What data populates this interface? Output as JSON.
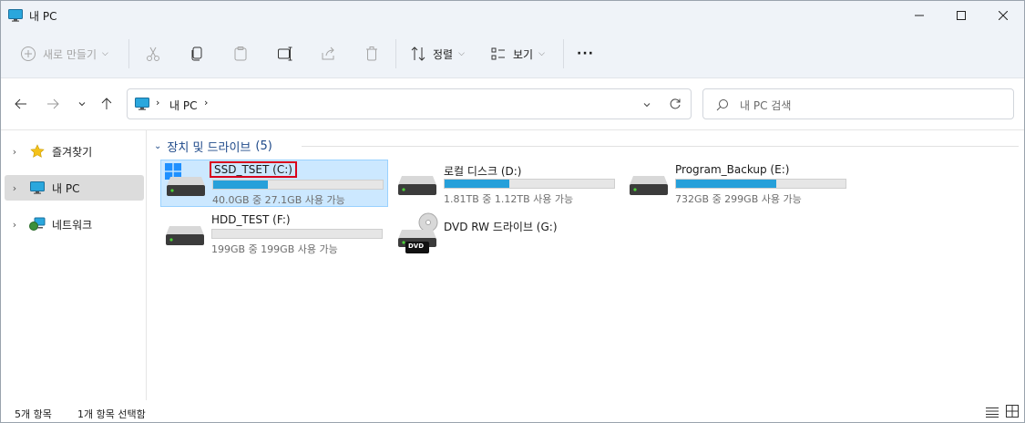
{
  "window": {
    "title": "내 PC"
  },
  "toolbar": {
    "new_label": "새로 만들기",
    "sort_label": "정렬",
    "view_label": "보기",
    "more_label": "···"
  },
  "nav": {
    "address": [
      "내 PC"
    ],
    "search_placeholder": "내 PC 검색"
  },
  "sidebar": {
    "items": [
      {
        "label": "즐겨찾기",
        "icon": "star-icon"
      },
      {
        "label": "내 PC",
        "icon": "computer-icon"
      },
      {
        "label": "네트워크",
        "icon": "network-icon"
      }
    ]
  },
  "group": {
    "title": "장치 및 드라이브",
    "count": "(5)"
  },
  "drives": [
    {
      "name": "SSD_TSET (C:)",
      "free_text": "40.0GB 중 27.1GB 사용 가능",
      "used_fraction": 0.32,
      "icon": "windows-drive-icon"
    },
    {
      "name": "로컬 디스크 (D:)",
      "free_text": "1.81TB 중 1.12TB 사용 가능",
      "used_fraction": 0.38,
      "icon": "hard-drive-icon"
    },
    {
      "name": "Program_Backup (E:)",
      "free_text": "732GB 중 299GB 사용 가능",
      "used_fraction": 0.59,
      "icon": "hard-drive-icon"
    },
    {
      "name": "HDD_TEST (F:)",
      "free_text": "199GB 중 199GB 사용 가능",
      "used_fraction": 0.0,
      "icon": "hard-drive-icon"
    },
    {
      "name": "DVD RW 드라이브 (G:)",
      "icon": "dvd-drive-icon",
      "badge": "DVD"
    }
  ],
  "status": {
    "count": "5개 항목",
    "selected": "1개 항목 선택함"
  },
  "colors": {
    "accent": "#26a0da",
    "selection": "#cce8ff",
    "header": "#1f4a8a",
    "highlight_box": "#d9001b"
  }
}
